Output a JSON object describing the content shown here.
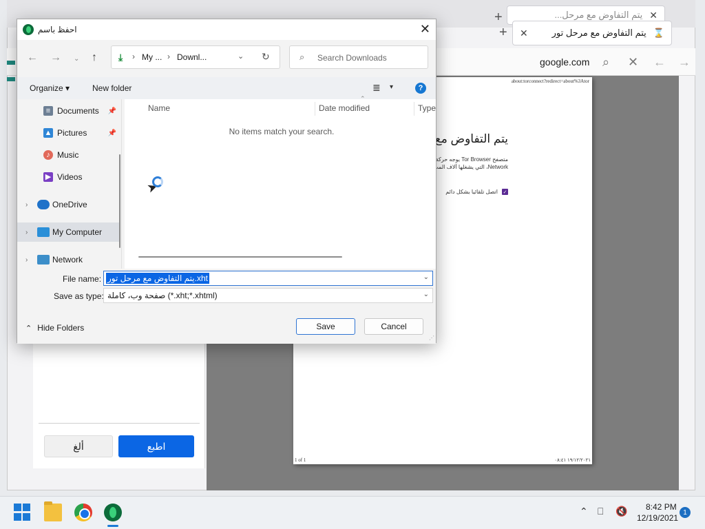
{
  "browser": {
    "tab_back_title": "يتم التفاوض مع مرحل...",
    "tab_title": "يتم التفاوض مع مرحل تور",
    "url_text": "google.com"
  },
  "print_panel": {
    "print_button": "اطبع",
    "cancel_button": "ألغ"
  },
  "print_page": {
    "header_url": "about:torconnect?redirect=about%3Ator",
    "heading": "يتم التفاوض مع",
    "desc_line1": "متصفح Tor Browser يوجه حركة",
    "desc_line2": "Network، التي يشغلها آلاف المت",
    "checkbox_label": "اتصل تلقائيا بشكل دائم",
    "footer_left": "1 of 1",
    "footer_right": "١٩/١٢/٢٠٢١ ٠٨:٤١"
  },
  "dialog": {
    "title": "احفظ باسم",
    "address_segment1": "My ...",
    "address_segment2": "Downl...",
    "search_placeholder": "Search Downloads",
    "organize": "Organize",
    "new_folder": "New folder",
    "help": "?",
    "nav_items": [
      {
        "label": "Documents",
        "icon": "documents-icon",
        "pinned": true
      },
      {
        "label": "Pictures",
        "icon": "pictures-icon",
        "pinned": true
      },
      {
        "label": "Music",
        "icon": "music-icon",
        "pinned": false
      },
      {
        "label": "Videos",
        "icon": "videos-icon",
        "pinned": false
      },
      {
        "label": "OneDrive",
        "icon": "onedrive-icon",
        "pinned": false
      },
      {
        "label": "My Computer",
        "icon": "computer-icon",
        "pinned": false,
        "selected": true
      },
      {
        "label": "Network",
        "icon": "network-icon",
        "pinned": false
      }
    ],
    "columns": [
      "Name",
      "Date modified",
      "Type"
    ],
    "empty_message": "No items match your search.",
    "filename_label": "File name:",
    "filename_value": "يتم التفاوض مع مرحل تور.xht",
    "savetype_label": "Save as type:",
    "savetype_value": "صفحة وب، كاملة (*.xht;*.xhtml)",
    "hide_folders": "Hide Folders",
    "save_button": "Save",
    "cancel_button": "Cancel"
  },
  "taskbar": {
    "time": "8:42 PM",
    "date": "12/19/2021",
    "notification_count": "1"
  },
  "colors": {
    "accent": "#0b66e4",
    "tor_green": "#0c6b3a",
    "selection": "#0b66e4"
  }
}
